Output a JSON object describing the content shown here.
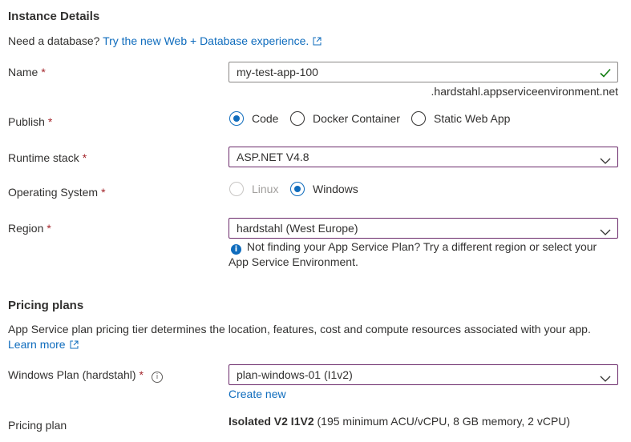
{
  "instance": {
    "title": "Instance Details",
    "db_prompt": "Need a database?",
    "db_link": "Try the new Web + Database experience.",
    "name": {
      "label": "Name",
      "required": "*",
      "value": "my-test-app-100",
      "suffix": ".hardstahl.appserviceenvironment.net"
    },
    "publish": {
      "label": "Publish",
      "required": "*",
      "options": [
        "Code",
        "Docker Container",
        "Static Web App"
      ],
      "selected": "Code"
    },
    "runtime": {
      "label": "Runtime stack",
      "required": "*",
      "value": "ASP.NET V4.8"
    },
    "os": {
      "label": "Operating System",
      "required": "*",
      "options": [
        "Linux",
        "Windows"
      ],
      "selected": "Windows"
    },
    "region": {
      "label": "Region",
      "required": "*",
      "value": "hardstahl (West Europe)",
      "info_line1": "Not finding your App Service Plan? Try a different region or select your",
      "info_line2": "App Service Environment."
    }
  },
  "pricing": {
    "title": "Pricing plans",
    "description": "App Service plan pricing tier determines the location, features, cost and compute resources associated with your app.",
    "learn_more": "Learn more",
    "windows_plan": {
      "label": "Windows Plan (hardstahl)",
      "required": "*",
      "value": "plan-windows-01 (I1v2)",
      "create_new": "Create new"
    },
    "pricing_plan": {
      "label": "Pricing plan",
      "tier": "Isolated V2 I1V2",
      "details": "(195 minimum ACU/vCPU, 8 GB memory, 2 vCPU)"
    }
  },
  "colors": {
    "accent": "#0f6cbd",
    "field_border": "#6b2b6b",
    "required": "#a4262c",
    "valid_check": "#107c10"
  }
}
